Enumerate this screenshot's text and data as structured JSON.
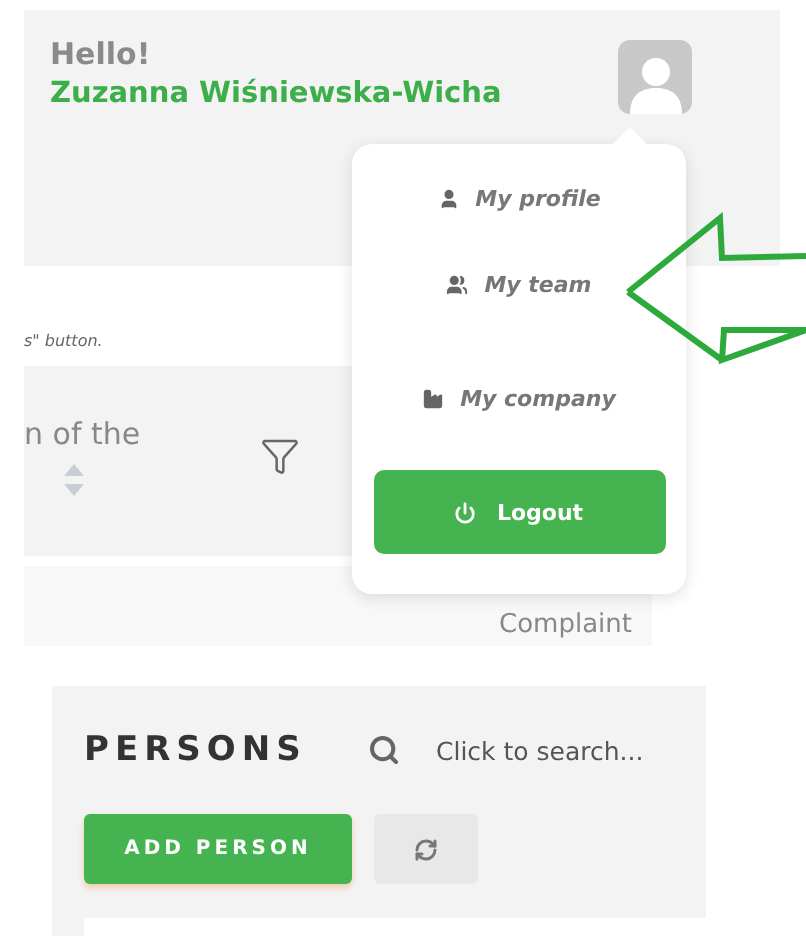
{
  "header": {
    "greeting": "Hello!",
    "user_name": "Zuzanna Wiśniewska-Wicha"
  },
  "note": "s\" button.",
  "table": {
    "column_header": "n of the",
    "row_cell": "Complaint"
  },
  "user_menu": {
    "items": [
      {
        "kind": "profile",
        "label": "My profile"
      },
      {
        "kind": "team",
        "label": "My team"
      },
      {
        "kind": "company",
        "label": "My company"
      }
    ],
    "logout": "Logout"
  },
  "persons": {
    "title": "PERSONS",
    "search": {
      "placeholder": "Click to search..."
    },
    "add_button": "ADD PERSON"
  }
}
